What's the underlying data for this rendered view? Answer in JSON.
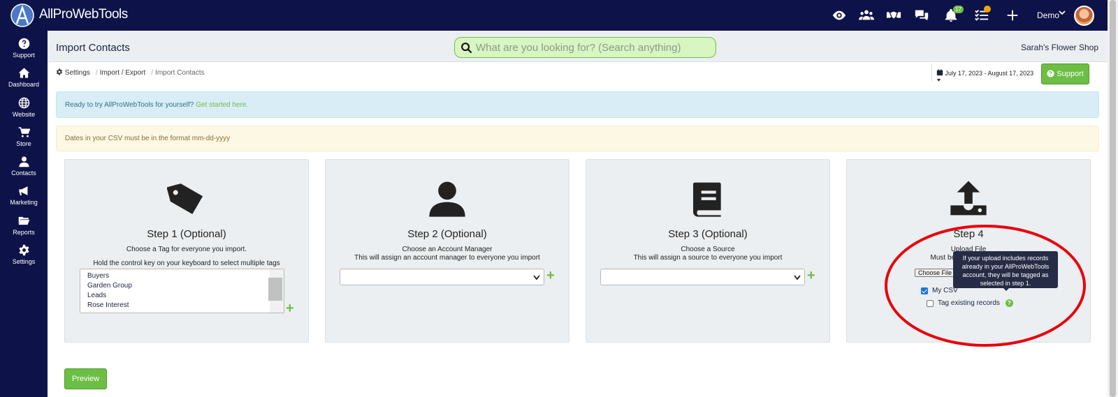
{
  "app": {
    "brand": "AllProWebTools",
    "user": "Demo"
  },
  "topbar": {
    "icons": [
      "eye-icon",
      "users-icon",
      "handshake-icon",
      "comments-icon",
      "bell-icon",
      "tasks-icon",
      "plus-icon"
    ],
    "badges": {
      "notifications": "17",
      "tasks": ""
    }
  },
  "sidebar": {
    "items": [
      {
        "label": "Support",
        "icon": "question-circle-icon"
      },
      {
        "label": "Dashboard",
        "icon": "home-icon"
      },
      {
        "label": "Website",
        "icon": "globe-icon"
      },
      {
        "label": "Store",
        "icon": "cart-icon"
      },
      {
        "label": "Contacts",
        "icon": "user-icon"
      },
      {
        "label": "Marketing",
        "icon": "bullhorn-icon"
      },
      {
        "label": "Reports",
        "icon": "folder-open-icon"
      },
      {
        "label": "Settings",
        "icon": "gear-icon"
      }
    ]
  },
  "header": {
    "title": "Import Contacts",
    "search_placeholder": "What are you looking for? (Search anything)",
    "shop": "Sarah's Flower Shop"
  },
  "breadcrumb": {
    "settings": "Settings",
    "import_export": "Import / Export",
    "current": "Import Contacts"
  },
  "date_range": "July 17, 2023 - August 17, 2023",
  "support_label": "Support",
  "alerts": {
    "info_text": "Ready to try AllProWebTools for yourself?",
    "info_link": "Get started here.",
    "warning": "Dates in your CSV must be in the format mm-dd-yyyy"
  },
  "steps": {
    "step1": {
      "title": "Step 1 (Optional)",
      "line1": "Choose a Tag for everyone you import.",
      "line2": "Hold the control key on your keyboard to select multiple tags",
      "tags": [
        "Buyers",
        "Garden Group",
        "Leads",
        "Rose Interest"
      ]
    },
    "step2": {
      "title": "Step 2 (Optional)",
      "line1": "Choose an Account Manager",
      "line2": "This will assign an account manager to everyone you import"
    },
    "step3": {
      "title": "Step 3 (Optional)",
      "line1": "Choose a Source",
      "line2": "This will assign a source to everyone you import"
    },
    "step4": {
      "title": "Step 4",
      "line1": "Upload File",
      "line2": "Must be sa",
      "file_button": "Choose File",
      "csv_checkbox_label": "My CSV",
      "csv_checked": true,
      "tag_existing_label": "Tag existing records",
      "tag_existing_checked": false,
      "tooltip": "If your upload includes records already in your AllProWebTools account, they will be tagged as selected in step 1."
    }
  },
  "preview_label": "Preview",
  "colors": {
    "nav": "#0d1349",
    "accent_green": "#6cbe45",
    "annotation": "#e8000b"
  }
}
